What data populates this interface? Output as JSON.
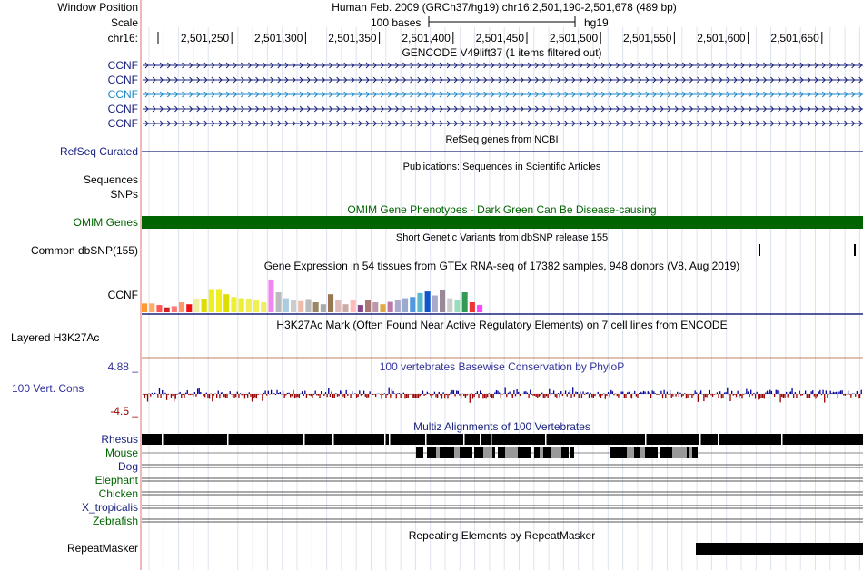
{
  "header": {
    "window_position_label": "Window Position",
    "scale_label": "Scale",
    "chrom_label": "chr16:",
    "assembly_info": "Human Feb. 2009 (GRCh37/hg19)   chr16:2,501,190-2,501,678 (489 bp)",
    "scale_text": "100 bases",
    "scale_db": "hg19",
    "ticks": [
      "2,501,250",
      "2,501,300",
      "2,501,350",
      "2,501,400",
      "2,501,450",
      "2,501,500",
      "2,501,550",
      "2,501,600",
      "2,501,650"
    ]
  },
  "gencode": {
    "title": "GENCODE V49lift37 (1 items filtered out)",
    "items": [
      "CCNF",
      "CCNF",
      "CCNF",
      "CCNF",
      "CCNF"
    ],
    "colors": [
      "#1a237e",
      "#1a237e",
      "#1e88c8",
      "#1a237e",
      "#1a237e"
    ]
  },
  "refseq": {
    "label": "RefSeq Curated",
    "title": "RefSeq genes from NCBI",
    "color": "#1a237e"
  },
  "publications": {
    "label_1": "Sequences",
    "label_2": "SNPs",
    "title": "Publications: Sequences in Scientific Articles"
  },
  "omim": {
    "label": "OMIM Genes",
    "title": "OMIM Gene Phenotypes - Dark Green Can Be Disease-causing",
    "color": "#006400"
  },
  "dbsnp": {
    "label": "Common dbSNP(155)",
    "title": "Short Genetic Variants from dbSNP release 155"
  },
  "gtex": {
    "label": "CCNF",
    "title": "Gene Expression in 54 tissues from GTEx RNA-seq of 17382 samples, 948 donors (V8, Aug 2019)",
    "bar_heights": [
      0.22,
      0.22,
      0.18,
      0.12,
      0.15,
      0.25,
      0.2,
      0.34,
      0.34,
      0.58,
      0.58,
      0.45,
      0.38,
      0.35,
      0.34,
      0.3,
      0.25,
      0.82,
      0.5,
      0.35,
      0.3,
      0.28,
      0.33,
      0.25,
      0.2,
      0.45,
      0.3,
      0.2,
      0.32,
      0.18,
      0.3,
      0.25,
      0.2,
      0.26,
      0.3,
      0.35,
      0.38,
      0.48,
      0.52,
      0.42,
      0.55,
      0.35,
      0.3,
      0.5,
      0.25,
      0.18
    ],
    "bar_colors": [
      "#ff9933",
      "#ffaa66",
      "#ff5555",
      "#cc2222",
      "#ff7777",
      "#ff9966",
      "#ee1111",
      "#eeeea0",
      "#dddd00",
      "#eeee22",
      "#eeee22",
      "#dddd00",
      "#eeee33",
      "#eeee33",
      "#eeee55",
      "#f0f055",
      "#eeee66",
      "#ee88ee",
      "#bbbbbb",
      "#aaccdd",
      "#cccccc",
      "#eebbaa",
      "#bbbbbb",
      "#998866",
      "#aaaaaa",
      "#997755",
      "#ddbbbb",
      "#ccaaaa",
      "#ffbbbb",
      "#884488",
      "#aa7777",
      "#bb99aa",
      "#ddaa44",
      "#bb77aa",
      "#aaaacc",
      "#99aacc",
      "#5599dd",
      "#55bbcc",
      "#1155cc",
      "#aaaacc",
      "#998899",
      "#cccccc",
      "#99ddbb",
      "#339955",
      "#ee3333",
      "#ff44ff"
    ]
  },
  "h3k27ac": {
    "label": "Layered H3K27Ac",
    "title": "H3K27Ac Mark (Often Found Near Active Regulatory Elements) on 7 cell lines from ENCODE"
  },
  "conservation": {
    "label": "100 Vert. Cons",
    "max_label": "4.88 _",
    "min_label": "-4.5 _",
    "title": "100 vertebrates Basewise Conservation by PhyloP",
    "color": "#333399",
    "pos_color": "#000099",
    "neg_color": "#990000"
  },
  "multiz": {
    "title": "Multiz Alignments of 100 Vertebrates",
    "species": [
      {
        "name": "Rhesus",
        "color": "#1a237e"
      },
      {
        "name": "Mouse",
        "color": "#006400"
      },
      {
        "name": "Dog",
        "color": "#1a237e"
      },
      {
        "name": "Elephant",
        "color": "#006400"
      },
      {
        "name": "Chicken",
        "color": "#006400"
      },
      {
        "name": "X_tropicalis",
        "color": "#1a237e"
      },
      {
        "name": "Zebrafish",
        "color": "#006400"
      }
    ]
  },
  "repeatmasker": {
    "label": "RepeatMasker",
    "title": "Repeating Elements by RepeatMasker"
  }
}
